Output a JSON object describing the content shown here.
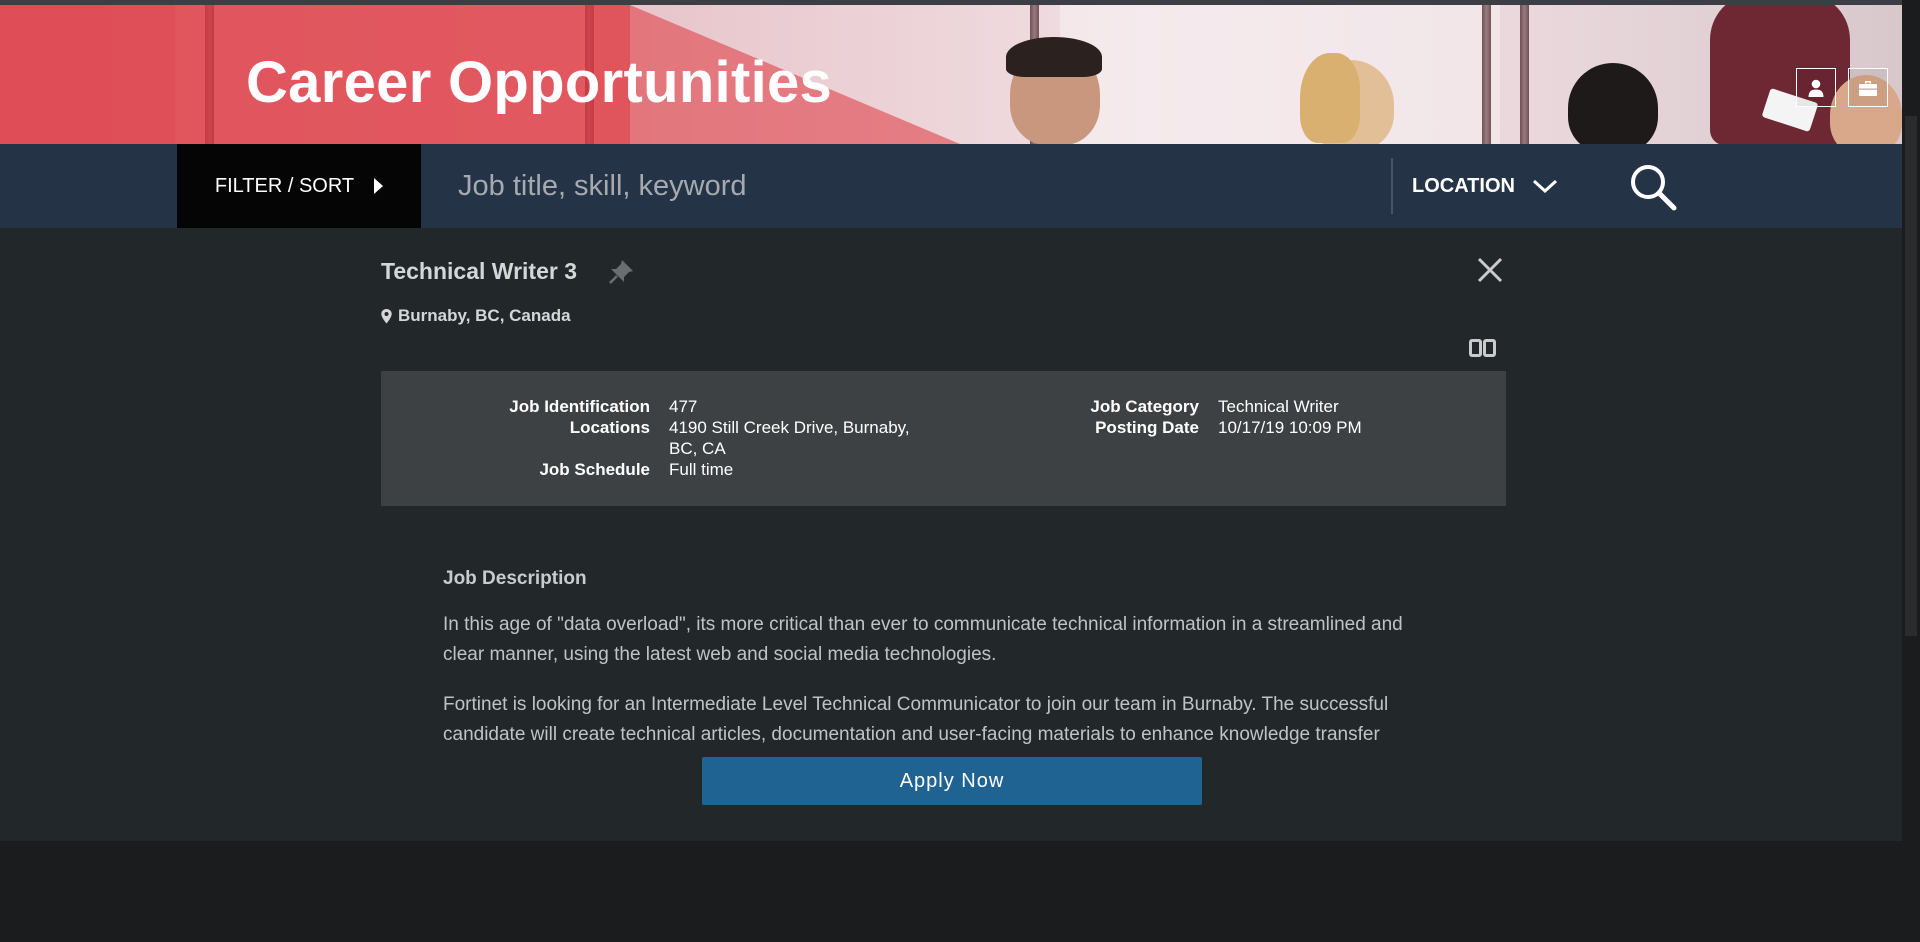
{
  "hero": {
    "title": "Career Opportunities",
    "profile_icon": "user-icon",
    "jobcart_icon": "briefcase-icon"
  },
  "search": {
    "filter_label": "FILTER / SORT",
    "keyword_placeholder": "Job title, skill, keyword",
    "location_label": "LOCATION",
    "search_icon": "search-icon"
  },
  "job": {
    "title": "Technical Writer 3",
    "location": "Burnaby, BC, Canada",
    "details_left": [
      {
        "label": "Job Identification",
        "value": "477"
      },
      {
        "label": "Locations",
        "value": "4190 Still Creek Drive, Burnaby, BC, CA"
      },
      {
        "label": "Job Schedule",
        "value": "Full time"
      }
    ],
    "details_right": [
      {
        "label": "Job Category",
        "value": "Technical Writer"
      },
      {
        "label": "Posting Date",
        "value": "10/17/19 10:09 PM"
      }
    ],
    "description_heading": "Job Description",
    "description_paragraphs": [
      "In this age of \"data overload\", its more critical than ever to communicate technical information in a streamlined and clear manner, using the latest web and social media technologies.",
      "Fortinet is looking for an Intermediate Level Technical Communicator to join our team in Burnaby. The successful candidate will create technical articles, documentation and user-facing materials to enhance knowledge transfer"
    ],
    "apply_label": "Apply Now"
  },
  "colors": {
    "hero_red": "#de343e",
    "search_bar_bg": "#243345",
    "panel_bg": "#222829",
    "info_box_bg": "#3d4144",
    "apply_blue": "#1f6393"
  }
}
